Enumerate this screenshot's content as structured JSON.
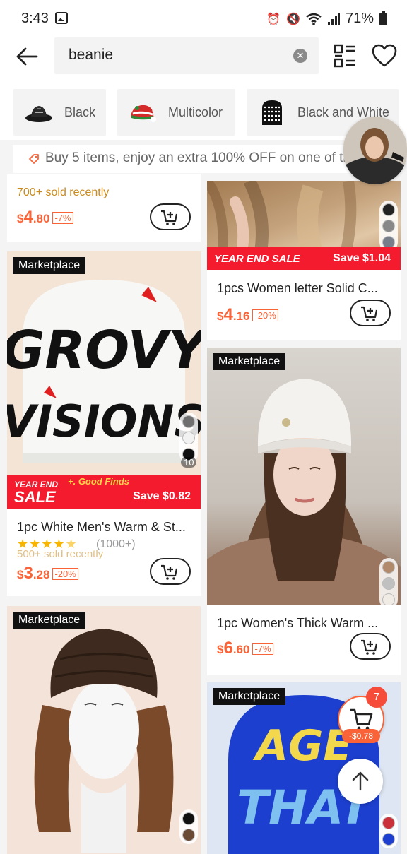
{
  "status": {
    "time": "3:43",
    "battery": "71%"
  },
  "search": {
    "query": "beanie"
  },
  "chips": [
    {
      "label": "Black"
    },
    {
      "label": "Multicolor"
    },
    {
      "label": "Black and White"
    }
  ],
  "promo": {
    "text": "Buy 5 items, enjoy an extra 100% OFF on one of th"
  },
  "products": {
    "p1": {
      "sold": "700+ sold recently",
      "currency": "$",
      "price_int": "4",
      "price_dec": ".80",
      "discount": "-7%"
    },
    "p2": {
      "sale_label": "YEAR END SALE",
      "save": "Save $1.04",
      "title": "1pcs Women letter Solid C...",
      "currency": "$",
      "price_int": "4",
      "price_dec": ".16",
      "discount": "-20%"
    },
    "p3": {
      "badge": "Marketplace",
      "img_text_1": "GROVY",
      "img_text_2": "VISIONS",
      "count": "10",
      "sale_label_1": "YEAR END",
      "sale_label_2": "SALE",
      "good_finds": "+. Good Finds",
      "save": "Save $0.82",
      "title": "1pc White Men's Warm & St...",
      "rating_count": "(1000+)",
      "sold": "500+ sold recently",
      "currency": "$",
      "price_int": "3",
      "price_dec": ".28",
      "discount": "-20%",
      "rating": 4.5
    },
    "p4": {
      "badge": "Marketplace",
      "title": "1pc Women's Thick Warm ...",
      "currency": "$",
      "price_int": "6",
      "price_dec": ".60",
      "discount": "-7%"
    },
    "p5": {
      "badge": "Marketplace"
    },
    "p6": {
      "badge": "Marketplace",
      "img_text_1": "AGE",
      "img_text_2": "THAT"
    }
  },
  "cart": {
    "count": "7",
    "save": "-$0.78"
  },
  "colors": {
    "accent": "#fa6338",
    "sale_red": "#f31b2d",
    "sold_text": "#c98a1e",
    "star": "#f7b500"
  }
}
